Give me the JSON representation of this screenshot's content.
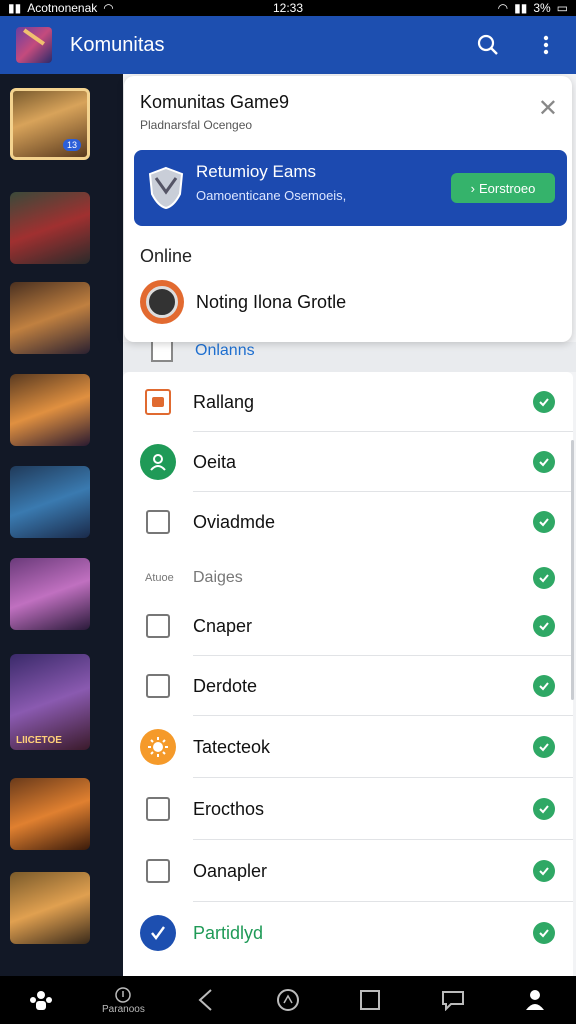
{
  "status_bar": {
    "carrier": "Acotnonenak",
    "time": "12:33",
    "battery": "3%"
  },
  "app_bar": {
    "title": "Komunitas"
  },
  "rail": {
    "tiles": [
      {
        "badge": "13",
        "caption": ""
      },
      {
        "badge": "",
        "caption": ""
      },
      {
        "badge": "",
        "caption": ""
      },
      {
        "badge": "",
        "caption": ""
      },
      {
        "badge": "",
        "caption": ""
      },
      {
        "badge": "",
        "caption": ""
      },
      {
        "badge": "",
        "caption": "LIICETOE"
      },
      {
        "badge": "",
        "caption": ""
      },
      {
        "badge": "",
        "caption": ""
      }
    ]
  },
  "card": {
    "title": "Komunitas Game9",
    "subtitle": "Pladnarsfal Ocengeo",
    "promo": {
      "title": "Retumioy Eams",
      "subtitle": "Oamoenticane Osemoeis,",
      "button": "Eorstroeo"
    },
    "online_label": "Online",
    "online_user": "Noting Ilona Grotle"
  },
  "list": {
    "header_label": "Onlanns",
    "rows": [
      {
        "label": "Rallang",
        "type": "rows-orange"
      },
      {
        "label": "Oeita",
        "type": "green-circle"
      },
      {
        "label": "Oviadmde",
        "type": "checkbox"
      }
    ],
    "section": {
      "tag": "Atuoe",
      "label": "Daiges"
    },
    "rows2": [
      {
        "label": "Cnaper",
        "type": "checkbox"
      },
      {
        "label": "Derdote",
        "type": "checkbox"
      },
      {
        "label": "Tatecteok",
        "type": "orange-sun"
      },
      {
        "label": "Erocthos",
        "type": "checkbox"
      },
      {
        "label": "Oanapler",
        "type": "checkbox"
      },
      {
        "label": "Partidlyd",
        "type": "blue-check"
      }
    ]
  },
  "bottom_nav": {
    "item2": "Paranoos"
  },
  "colors": {
    "brand_blue": "#1d4fb0",
    "accent_green": "#35b36b",
    "check_green": "#2fa865"
  }
}
